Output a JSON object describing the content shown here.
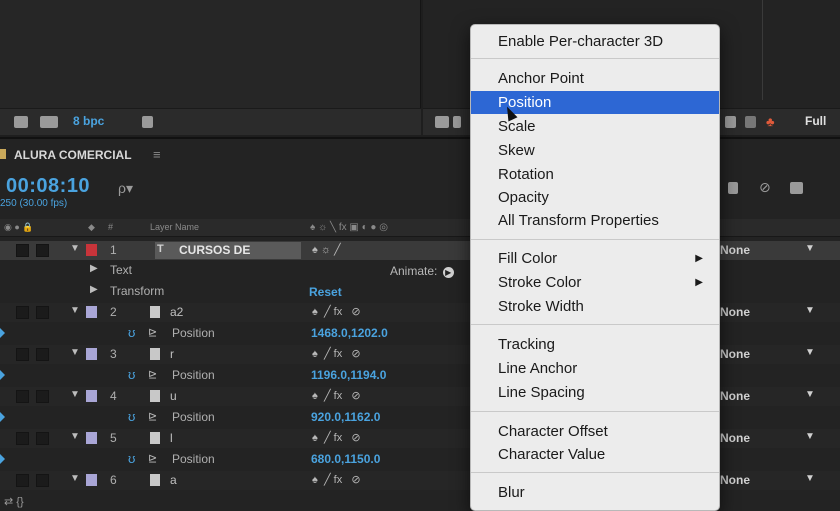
{
  "project": {
    "bpc_label": "8 bpc"
  },
  "viewer": {
    "resolution_label": "Full"
  },
  "timeline": {
    "comp_name": "ALURA COMERCIAL",
    "comp_menu_glyph": "≡",
    "timecode": "00:08:10",
    "fps_label": "250 (30.00 fps)",
    "search_glyph": "ρ▾",
    "header": {
      "num": "#",
      "layer_name": "Layer Name"
    },
    "layer1": {
      "num": "1",
      "name": "CURSOS DE",
      "type_icon": "T"
    },
    "text_group": "Text",
    "animate_label": "Animate:",
    "transform_group": "Transform",
    "reset_label": "Reset",
    "layers": [
      {
        "num": "2",
        "name": "a2",
        "prop": "Position",
        "value": "1468.0,1202.0",
        "parent": "None"
      },
      {
        "num": "3",
        "name": "r",
        "prop": "Position",
        "value": "1196.0,1194.0",
        "parent": "None"
      },
      {
        "num": "4",
        "name": "u",
        "prop": "Position",
        "value": "920.0,1162.0",
        "parent": "None"
      },
      {
        "num": "5",
        "name": "l",
        "prop": "Position",
        "value": "680.0,1150.0",
        "parent": "None"
      },
      {
        "num": "6",
        "name": "a",
        "parent": "None"
      }
    ],
    "layer1_parent": "None",
    "bottom_glyph": "⇄ {}"
  },
  "context_menu": {
    "items": [
      {
        "label": "Enable Per-character 3D"
      },
      {
        "label": "Anchor Point"
      },
      {
        "label": "Position",
        "highlighted": true
      },
      {
        "label": "Scale"
      },
      {
        "label": "Skew"
      },
      {
        "label": "Rotation"
      },
      {
        "label": "Opacity"
      },
      {
        "label": "All Transform Properties"
      },
      {
        "label": "Fill Color",
        "submenu": true
      },
      {
        "label": "Stroke Color",
        "submenu": true
      },
      {
        "label": "Stroke Width"
      },
      {
        "label": "Tracking"
      },
      {
        "label": "Line Anchor"
      },
      {
        "label": "Line Spacing"
      },
      {
        "label": "Character Offset"
      },
      {
        "label": "Character Value"
      },
      {
        "label": "Blur"
      }
    ]
  },
  "colors": {
    "accent_blue": "#4aa3df",
    "menu_highlight": "#2d67d4",
    "label_red": "#c8343a",
    "label_lavender": "#a9a6d6"
  }
}
